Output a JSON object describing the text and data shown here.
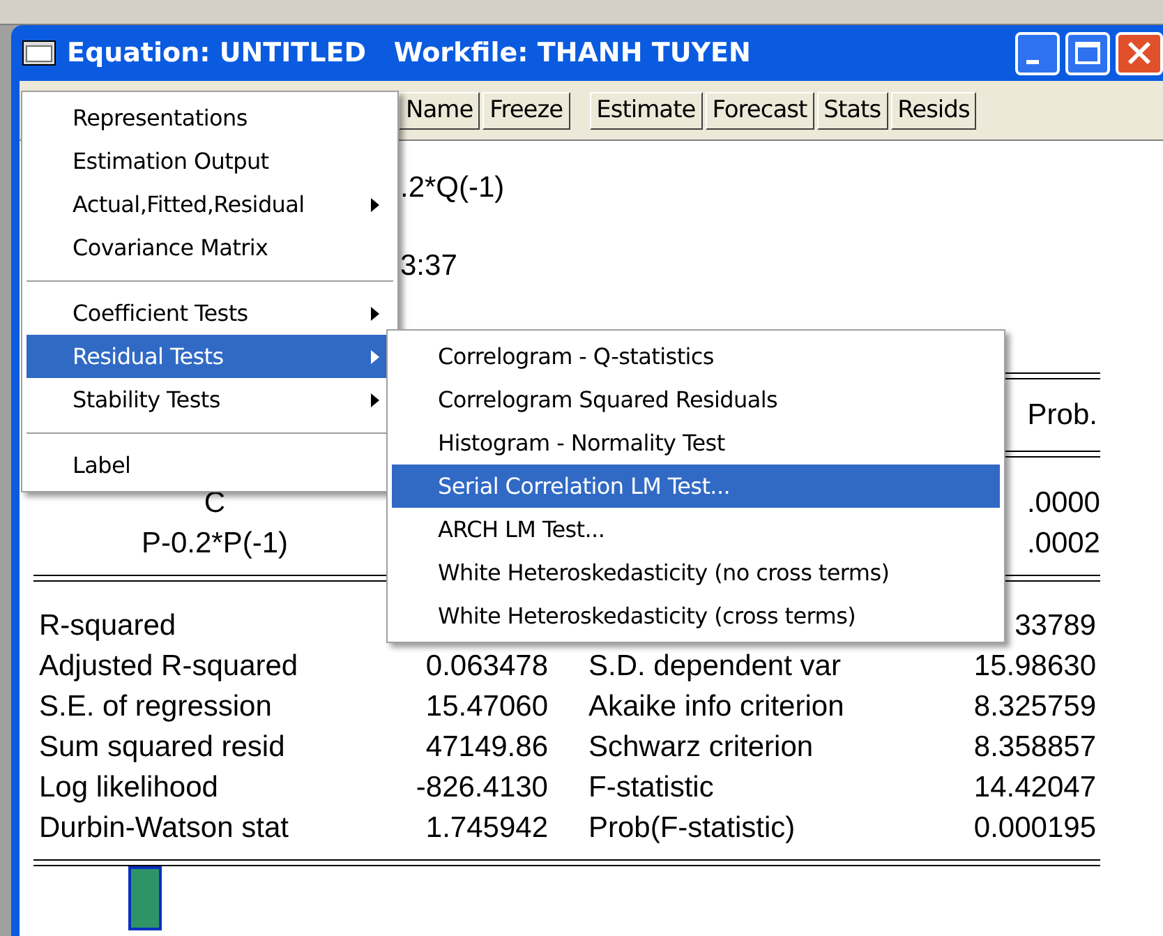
{
  "window": {
    "title": "Equation: UNTITLED   Workfile: THANH TUYEN"
  },
  "toolbar": [
    "Name",
    "Freeze",
    "Estimate",
    "Forecast",
    "Stats",
    "Resids"
  ],
  "output_lines": [
    ".2*Q(-1)",
    "3:37"
  ],
  "coefficients": {
    "header": "Prob.",
    "rows": [
      {
        "variable": "C",
        "prob": ".0000"
      },
      {
        "variable": "P-0.2*P(-1)",
        "prob": ".0002"
      }
    ]
  },
  "statistics": [
    {
      "label": "R-squared",
      "value2": "33789"
    },
    {
      "label": "Adjusted R-squared",
      "value": "0.063478",
      "label2": "S.D. dependent var",
      "value2": "15.98630"
    },
    {
      "label": "S.E. of regression",
      "value": "15.47060",
      "label2": "Akaike info criterion",
      "value2": "8.325759"
    },
    {
      "label": "Sum squared resid",
      "value": "47149.86",
      "label2": "Schwarz criterion",
      "value2": "8.358857"
    },
    {
      "label": "Log likelihood",
      "value": "-826.4130",
      "label2": "F-statistic",
      "value2": "14.42047"
    },
    {
      "label": "Durbin-Watson stat",
      "value": "1.745942",
      "label2": "Prob(F-statistic)",
      "value2": "0.000195"
    }
  ],
  "view_menu": [
    {
      "kind": "item",
      "label": "Representations",
      "submenu": false,
      "selected": false
    },
    {
      "kind": "item",
      "label": "Estimation Output",
      "submenu": false,
      "selected": false
    },
    {
      "kind": "item",
      "label": "Actual,Fitted,Residual",
      "submenu": true,
      "selected": false
    },
    {
      "kind": "item",
      "label": "Covariance Matrix",
      "submenu": false,
      "selected": false
    },
    {
      "kind": "separator"
    },
    {
      "kind": "item",
      "label": "Coefficient Tests",
      "submenu": true,
      "selected": false
    },
    {
      "kind": "item",
      "label": "Residual Tests",
      "submenu": true,
      "selected": true
    },
    {
      "kind": "item",
      "label": "Stability Tests",
      "submenu": true,
      "selected": false
    },
    {
      "kind": "separator"
    },
    {
      "kind": "item",
      "label": "Label",
      "submenu": false,
      "selected": false
    }
  ],
  "submenu": [
    {
      "label": "Correlogram - Q-statistics",
      "selected": false
    },
    {
      "label": "Correlogram Squared Residuals",
      "selected": false
    },
    {
      "label": "Histogram - Normality Test",
      "selected": false
    },
    {
      "label": "Serial Correlation LM Test...",
      "selected": true
    },
    {
      "label": "ARCH LM Test...",
      "selected": false
    },
    {
      "label": "White Heteroskedasticity (no cross terms)",
      "selected": false
    },
    {
      "label": "White Heteroskedasticity (cross terms)",
      "selected": false
    }
  ]
}
